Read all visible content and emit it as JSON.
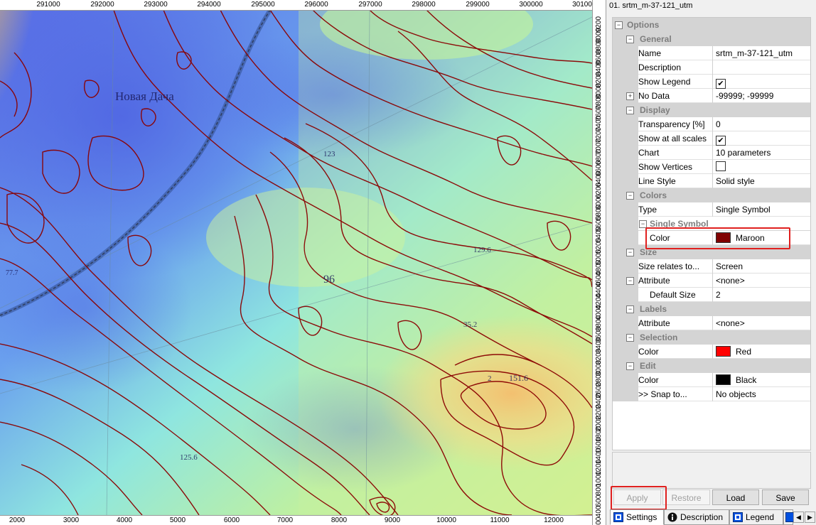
{
  "panel": {
    "title": "01. srtm_m-37-121_utm"
  },
  "rows": {
    "options": "Options",
    "general": "General",
    "name_label": "Name",
    "name_value": "srtm_m-37-121_utm",
    "description_label": "Description",
    "description_value": "",
    "show_legend_label": "Show Legend",
    "show_legend_checked": true,
    "no_data_label": "No Data",
    "no_data_value": "-99999; -99999",
    "display": "Display",
    "transparency_label": "Transparency [%]",
    "transparency_value": "0",
    "show_all_scales_label": "Show at all scales",
    "show_all_scales_checked": true,
    "chart_label": "Chart",
    "chart_value": "10 parameters",
    "show_vertices_label": "Show Vertices",
    "show_vertices_checked": false,
    "line_style_label": "Line Style",
    "line_style_value": "Solid style",
    "colors": "Colors",
    "type_label": "Type",
    "type_value": "Single Symbol",
    "single_symbol": "Single Symbol",
    "color_label": "Color",
    "color_value": "Maroon",
    "size": "Size",
    "size_relates_label": "Size relates to...",
    "size_relates_value": "Screen",
    "attribute_label": "Attribute",
    "attribute_value": "<none>",
    "default_size_label": "Default Size",
    "default_size_value": "2",
    "labels": "Labels",
    "labels_attribute_label": "Attribute",
    "labels_attribute_value": "<none>",
    "selection": "Selection",
    "selection_color_label": "Color",
    "selection_color_value": "Red",
    "edit": "Edit",
    "edit_color_label": "Color",
    "edit_color_value": "Black",
    "snap_label": ">> Snap to...",
    "snap_value": "No objects"
  },
  "colors": {
    "maroon": "#800000",
    "red": "#ff0000",
    "black": "#000000",
    "highlight": "#e0201f"
  },
  "buttons": {
    "apply": "Apply",
    "restore": "Restore",
    "load": "Load",
    "save": "Save"
  },
  "tabs": {
    "settings": "Settings",
    "description": "Description",
    "legend": "Legend"
  },
  "map_labels": {
    "novaya_dacha": "Новая Дача",
    "spot_77": "77.7",
    "spot_129": "129.6",
    "spot_151": "151.6",
    "spot_125": "125.6",
    "spot_123": "123",
    "spot_96": "96",
    "spot_35": "35.2",
    "spot_2": "2"
  },
  "ruler": {
    "top": [
      "291000",
      "292000",
      "293000",
      "294000",
      "295000",
      "296000",
      "297000",
      "298000",
      "299000",
      "300000",
      "30100"
    ],
    "bottom": [
      "2000",
      "3000",
      "4000",
      "5000",
      "6000",
      "7000",
      "8000",
      "9000",
      "10000",
      "11000",
      "12000"
    ],
    "right": [
      "9200",
      "9000",
      "8800",
      "8600",
      "8400",
      "8200",
      "8000",
      "7800",
      "7600",
      "7400",
      "7200",
      "7000",
      "6800",
      "6600",
      "6400",
      "6200",
      "6000",
      "5800",
      "5600",
      "5400",
      "5200",
      "5000",
      "4800",
      "4600",
      "4400",
      "4200",
      "4000",
      "3800",
      "3600",
      "3400",
      "3200",
      "3000",
      "2800",
      "2600",
      "2400",
      "2200",
      "2000",
      "1800",
      "1600",
      "1400",
      "1200",
      "1000",
      "800",
      "600",
      "400",
      "200"
    ]
  }
}
